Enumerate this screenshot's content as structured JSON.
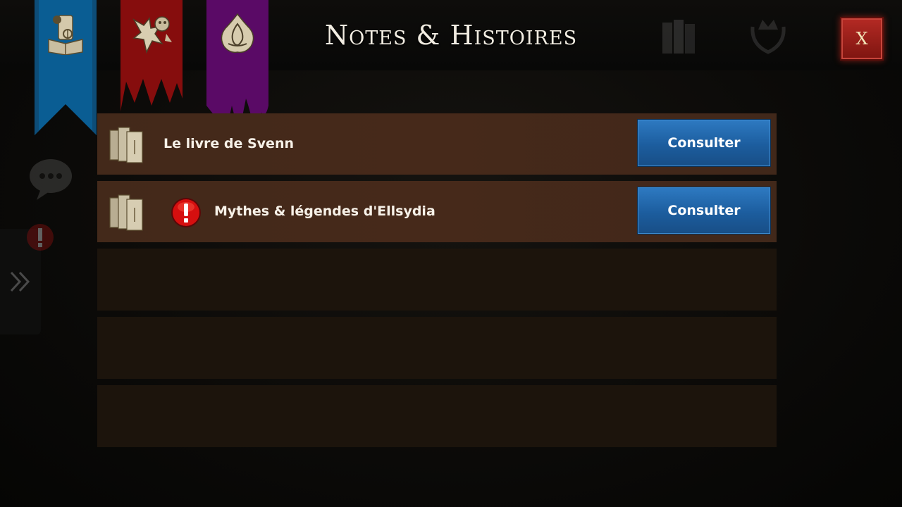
{
  "header": {
    "title": "Notes & Histoires",
    "close_label": "X"
  },
  "tabs": [
    {
      "name": "journal",
      "color": "#0a5d93",
      "icon": "book-scroll-icon",
      "active": true
    },
    {
      "name": "creatures",
      "color": "#860d0d",
      "icon": "dragon-icon",
      "active": false
    },
    {
      "name": "magic",
      "color": "#5a0a66",
      "icon": "flame-rune-icon",
      "active": false
    }
  ],
  "entries": [
    {
      "title": "Le livre de Svenn",
      "alert": false,
      "button": "Consulter"
    },
    {
      "title": "Mythes & légendes d'Ellsydia",
      "alert": true,
      "button": "Consulter"
    }
  ],
  "colors": {
    "row_bg": "#44291a",
    "empty_row_bg": "#1c140c",
    "button_blue": "#1f63a6",
    "close_red": "#9a1f19",
    "alert_red": "#d50f0f"
  }
}
